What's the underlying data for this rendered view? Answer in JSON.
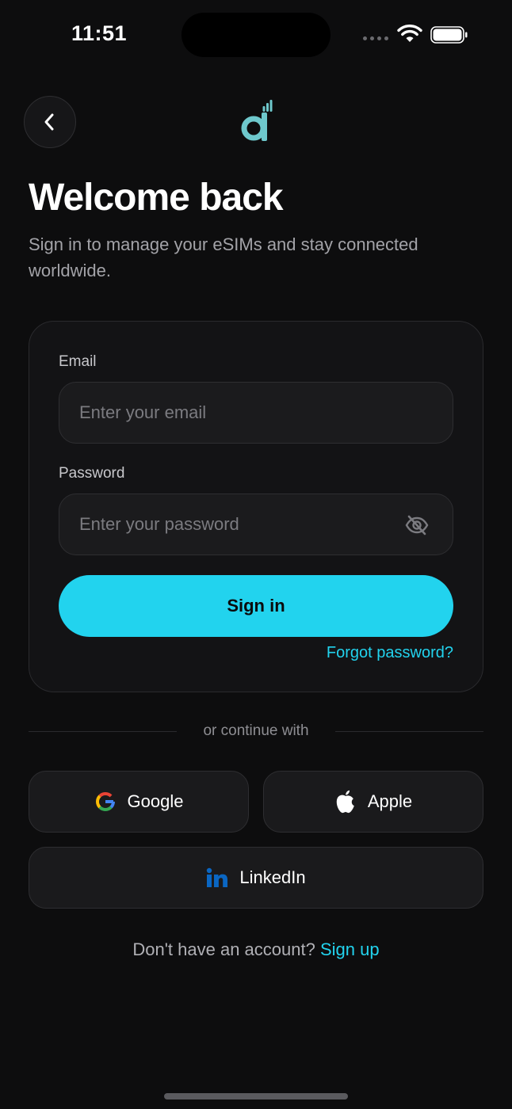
{
  "status_bar": {
    "time": "11:51"
  },
  "header": {
    "back_icon": "chevron-left-icon",
    "logo_icon": "app-logo-icon"
  },
  "page": {
    "title": "Welcome back",
    "subtitle": "Sign in to manage your eSIMs and stay connected worldwide."
  },
  "form": {
    "email_label": "Email",
    "email_placeholder": "Enter your email",
    "email_value": "",
    "password_label": "Password",
    "password_placeholder": "Enter your password",
    "password_value": "",
    "password_toggle_icon": "eye-off-icon",
    "signin_label": "Sign in",
    "forgot_label": "Forgot password?"
  },
  "divider": {
    "text": "or continue with"
  },
  "social": {
    "google_label": "Google",
    "apple_label": "Apple",
    "linkedin_label": "LinkedIn"
  },
  "footer": {
    "prompt": "Don't have an account?",
    "signup_label": "Sign up"
  },
  "colors": {
    "background": "#0d0d0e",
    "accent": "#22d3ee",
    "card": "#131315",
    "logo": "#6ec8cc",
    "linkedin": "#0a66c2"
  }
}
